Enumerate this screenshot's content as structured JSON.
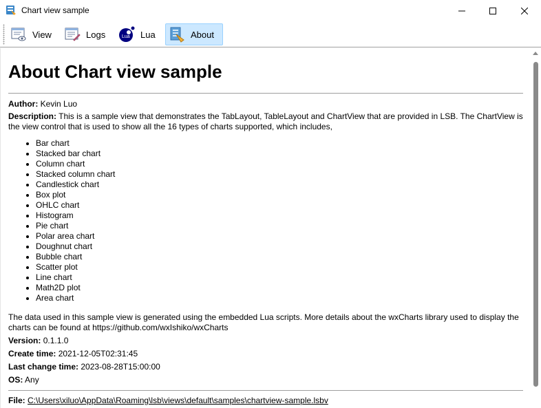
{
  "window": {
    "title": "Chart view sample",
    "app_icon": "chart-app-icon"
  },
  "toolbar": {
    "buttons": [
      {
        "label": "View",
        "icon": "view-icon"
      },
      {
        "label": "Logs",
        "icon": "logs-icon"
      },
      {
        "label": "Lua",
        "icon": "lua-icon"
      },
      {
        "label": "About",
        "icon": "about-icon",
        "active": true
      }
    ]
  },
  "about": {
    "title": "About Chart view sample",
    "author_label": "Author:",
    "author": "Kevin Luo",
    "description_label": "Description:",
    "description": "This is a sample view that demonstrates the TabLayout, TableLayout and ChartView that are provided in LSB. The ChartView is the view control that is used to show all the 16 types of charts supported, which includes,",
    "chart_types": [
      "Bar chart",
      "Stacked bar chart",
      "Column chart",
      "Stacked column chart",
      "Candlestick chart",
      "Box plot",
      "OHLC chart",
      "Histogram",
      "Pie chart",
      "Polar area chart",
      "Doughnut chart",
      "Bubble chart",
      "Scatter plot",
      "Line chart",
      "Math2D plot",
      "Area chart"
    ],
    "data_note": "The data used in this sample view is generated using the embedded Lua scripts. More details about the wxCharts library used to display the charts can be found at https://github.com/wxIshiko/wxCharts",
    "version_label": "Version:",
    "version": "0.1.1.0",
    "create_time_label": "Create time:",
    "create_time": "2021-12-05T02:31:45",
    "last_change_label": "Last change time:",
    "last_change": "2023-08-28T15:00:00",
    "os_label": "OS:",
    "os": "Any",
    "file_label": "File:",
    "file": "C:\\Users\\xiluo\\AppData\\Roaming\\lsb\\views\\default\\samples\\chartview-sample.lsbv"
  },
  "colors": {
    "active_tab_bg": "#cce8ff",
    "active_tab_border": "#99d1ff",
    "divider": "#9e9e9e",
    "scroll_thumb": "#8a8a8a"
  }
}
